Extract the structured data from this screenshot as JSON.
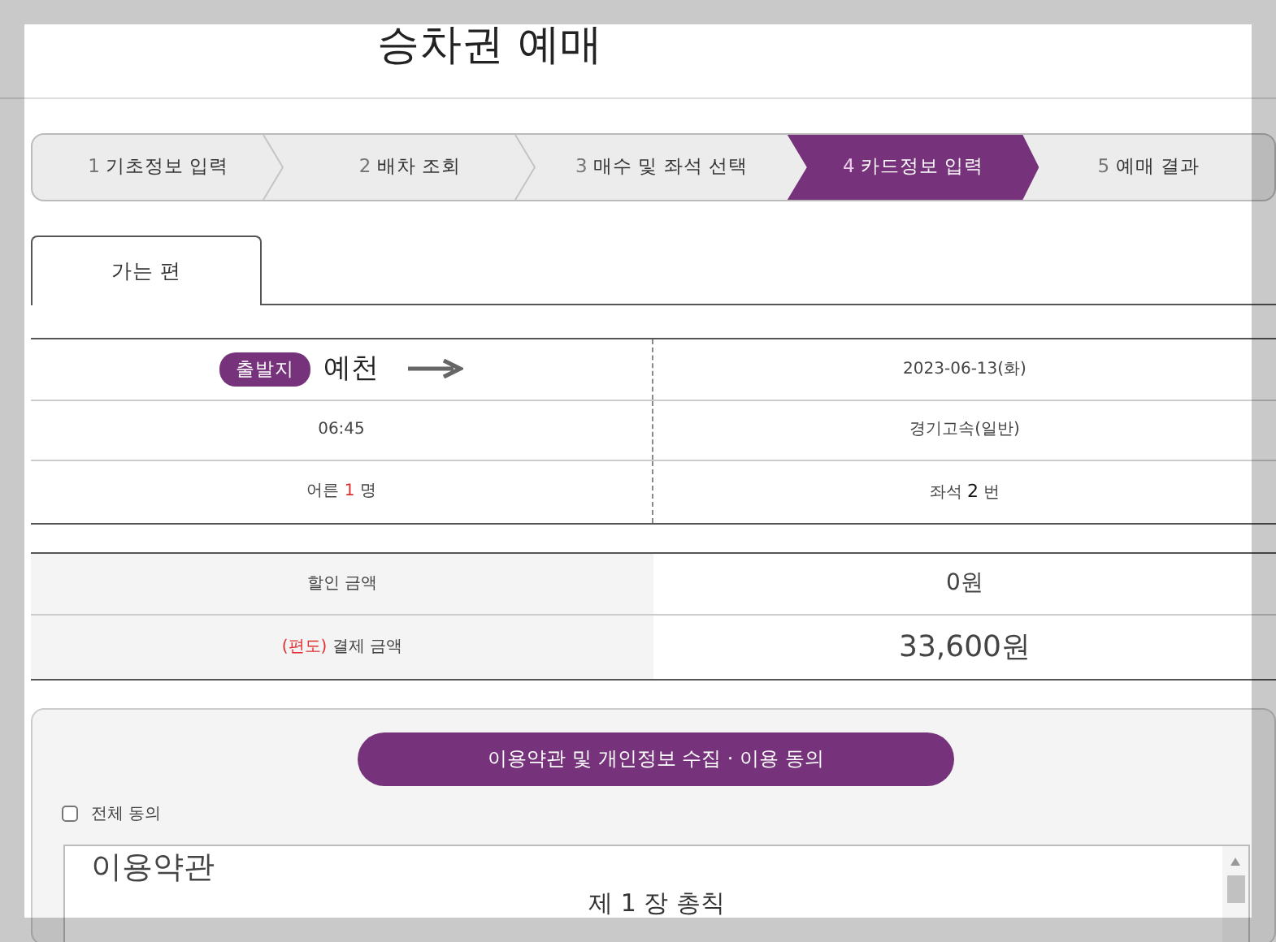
{
  "title": "승차권 예매",
  "steps": [
    {
      "number": "1",
      "label": "기초정보 입력",
      "selected": false
    },
    {
      "number": "2",
      "label": "배차 조회",
      "selected": false
    },
    {
      "number": "3",
      "label": "매수 및 좌석 선택",
      "selected": false
    },
    {
      "number": "4",
      "label": "카드정보 입력",
      "selected": true
    },
    {
      "number": "5",
      "label": "예매 결과",
      "selected": false
    }
  ],
  "tabs": [
    {
      "label": "가는 편",
      "selected": true
    }
  ],
  "trip": {
    "departure_badge": "출발지",
    "departure": "예천",
    "date": "2023-06-13(화)",
    "time": "06:45",
    "bus_class": "경기고속(일반)",
    "passengers": {
      "label": "어른",
      "count": "1",
      "unit": "명"
    },
    "seat": {
      "label": "좌석",
      "number": "2",
      "unit": "번"
    }
  },
  "fares": [
    {
      "label": "할인 금액",
      "value": "0원",
      "kind": "discount"
    },
    {
      "prefix": "(편도)",
      "label": "결제 금액",
      "value": "33,600원",
      "kind": "total"
    }
  ],
  "agreement": {
    "button": "이용약관 및 개인정보 수집 · 이용 동의",
    "agree_all": {
      "label": "전체 동의",
      "checked": false
    },
    "terms_title": "이용약관",
    "terms_heading": "제 1 장 총칙"
  }
}
